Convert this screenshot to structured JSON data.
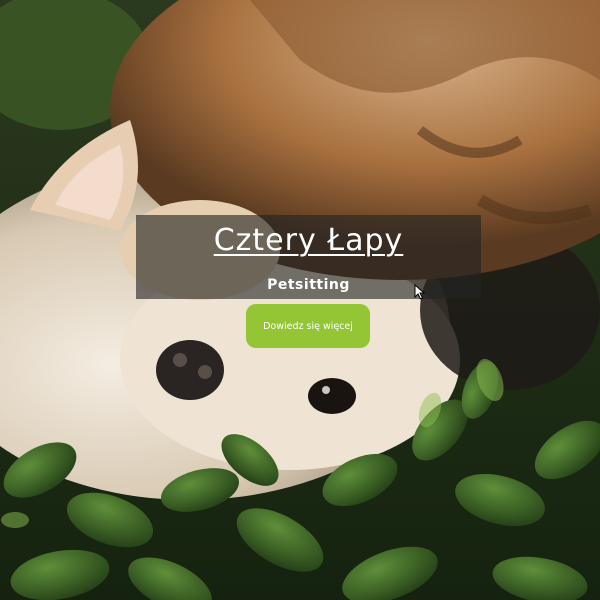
{
  "hero": {
    "title": "Cztery Łapy",
    "subtitle": "Petsitting",
    "cta_label": "Dowiedz się więcej"
  },
  "colors": {
    "accent": "#93c534",
    "overlay": "#232323"
  },
  "icons": {
    "pointer": "mouse-pointer-icon"
  }
}
